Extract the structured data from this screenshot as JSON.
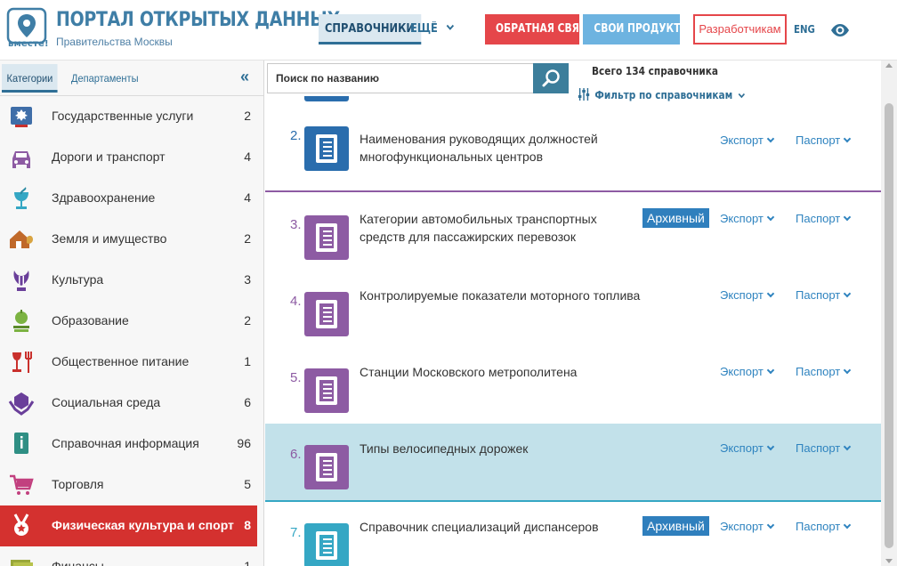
{
  "header": {
    "logo_text": "вместе!",
    "title": "ПОРТАЛ ОТКРЫТЫХ ДАННЫХ",
    "subtitle": "Правительства Москвы",
    "nav_reference": "СПРАВОЧНИКИ",
    "nav_more": "ЕЩЁ",
    "feedback": "ОБРАТНАЯ СВЯЗЬ",
    "products": "СВОИ ПРОДУКТЫ!",
    "developers": "Разработчикам",
    "language": "ENG",
    "colors": {
      "brand": "#3f7ea6",
      "feedback": "#e5464a",
      "products": "#6db3e0"
    }
  },
  "sidebar": {
    "tab_categories": "Категории",
    "tab_departments": "Департаменты",
    "collapse": "«",
    "items": [
      {
        "label": "Государственные услуги",
        "count": "2",
        "icon": "coat-of-arms-icon"
      },
      {
        "label": "Дороги и транспорт",
        "count": "4",
        "icon": "car-icon"
      },
      {
        "label": "Здравоохранение",
        "count": "4",
        "icon": "medical-bowl-icon"
      },
      {
        "label": "Земля и имущество",
        "count": "2",
        "icon": "house-icon"
      },
      {
        "label": "Культура",
        "count": "3",
        "icon": "lyre-icon"
      },
      {
        "label": "Образование",
        "count": "2",
        "icon": "apple-books-icon"
      },
      {
        "label": "Общественное питание",
        "count": "1",
        "icon": "wine-fork-icon"
      },
      {
        "label": "Социальная среда",
        "count": "6",
        "icon": "hands-icon"
      },
      {
        "label": "Справочная информация",
        "count": "96",
        "icon": "info-icon"
      },
      {
        "label": "Торговля",
        "count": "5",
        "icon": "cart-icon"
      },
      {
        "label": "Физическая культура и спорт",
        "count": "8",
        "icon": "medal-icon",
        "active": true
      },
      {
        "label": "Финансы",
        "count": "1",
        "icon": "money-icon"
      }
    ]
  },
  "search": {
    "placeholder": "Поиск по названию"
  },
  "summary": {
    "total": "Всего 134 справочника",
    "filter": "Фильтр по справочникам"
  },
  "list": {
    "export_label": "Экспорт",
    "passport_label": "Паспорт",
    "archive_label": "Архивный",
    "rows": [
      {
        "num": "2.",
        "title": "Наименования руководящих должностей многофункциональных центров",
        "color": "#2a6dad",
        "archive": false
      },
      {
        "num": "3.",
        "title": "Категории автомобильных транспортных средств для пассажирских перевозок",
        "color": "#8d5ba3",
        "archive": true
      },
      {
        "num": "4.",
        "title": "Контролируемые показатели моторного топлива",
        "color": "#8d5ba3",
        "archive": false
      },
      {
        "num": "5.",
        "title": "Станции Московского метрополитена",
        "color": "#8d5ba3",
        "archive": false
      },
      {
        "num": "6.",
        "title": "Типы велосипедных дорожек",
        "color": "#8d5ba3",
        "archive": false,
        "highlighted": true
      },
      {
        "num": "7.",
        "title": "Справочник специализаций диспансеров",
        "color": "#35a7c4",
        "archive": true
      }
    ]
  }
}
